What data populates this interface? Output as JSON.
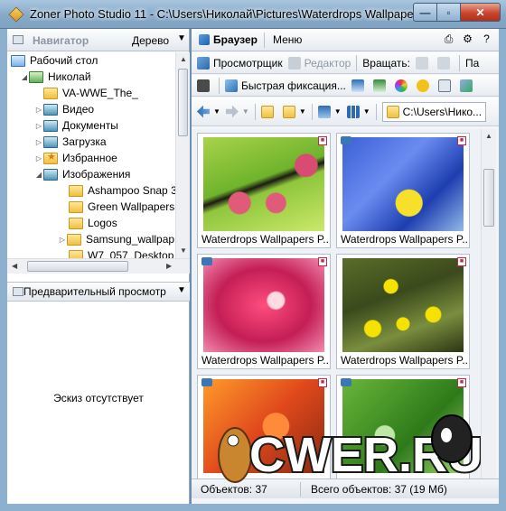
{
  "window": {
    "title": "Zoner Photo Studio 11 - C:\\Users\\Николай\\Pictures\\Waterdrops Wallpapers ...",
    "minimize": "—",
    "maximize": "▫",
    "close": "✕"
  },
  "navigator": {
    "title": "Навигатор",
    "mode": "Дерево",
    "tree": [
      {
        "label": "Рабочий стол",
        "icon": "desktop-icon"
      },
      {
        "label": "Николай",
        "icon": "user-folder-icon"
      },
      {
        "label": "VA-WWE_The_",
        "icon": "folder-icon"
      },
      {
        "label": "Видео",
        "icon": "video-folder-icon"
      },
      {
        "label": "Документы",
        "icon": "documents-folder-icon"
      },
      {
        "label": "Загрузка",
        "icon": "downloads-folder-icon"
      },
      {
        "label": "Избранное",
        "icon": "favorites-folder-icon"
      },
      {
        "label": "Изображения",
        "icon": "pictures-folder-icon"
      },
      {
        "label": "Ashampoo Snap 3",
        "icon": "folder-icon"
      },
      {
        "label": "Green Wallpapers",
        "icon": "folder-icon"
      },
      {
        "label": "Logos",
        "icon": "folder-icon"
      },
      {
        "label": "Samsung_wallpap",
        "icon": "folder-icon"
      },
      {
        "label": "W7_057_Desktop",
        "icon": "folder-icon"
      }
    ]
  },
  "preview": {
    "title": "Предварительный просмотр",
    "empty_text": "Эскиз отсутствует"
  },
  "browser": {
    "tab_browser": "Браузер",
    "tab_menu": "Меню",
    "toolbar1": {
      "viewer": "Просмотрщик",
      "editor": "Редактор",
      "rotate": "Вращать:",
      "more": "Па"
    },
    "toolbar2": {
      "quick_fix": "Быстрая фиксация..."
    },
    "toolbar3": {
      "path": "C:\\Users\\Нико..."
    },
    "thumbnails": [
      {
        "caption": "Waterdrops Wallpapers P..."
      },
      {
        "caption": "Waterdrops Wallpapers P..."
      },
      {
        "caption": "Waterdrops Wallpapers P..."
      },
      {
        "caption": "Waterdrops Wallpapers P..."
      },
      {
        "caption": ""
      },
      {
        "caption": ""
      }
    ],
    "status": {
      "objects": "Объектов: 37",
      "total": "Всего объектов: 37 (19 Мб)"
    }
  },
  "watermark": {
    "text": "CWER.RU"
  }
}
